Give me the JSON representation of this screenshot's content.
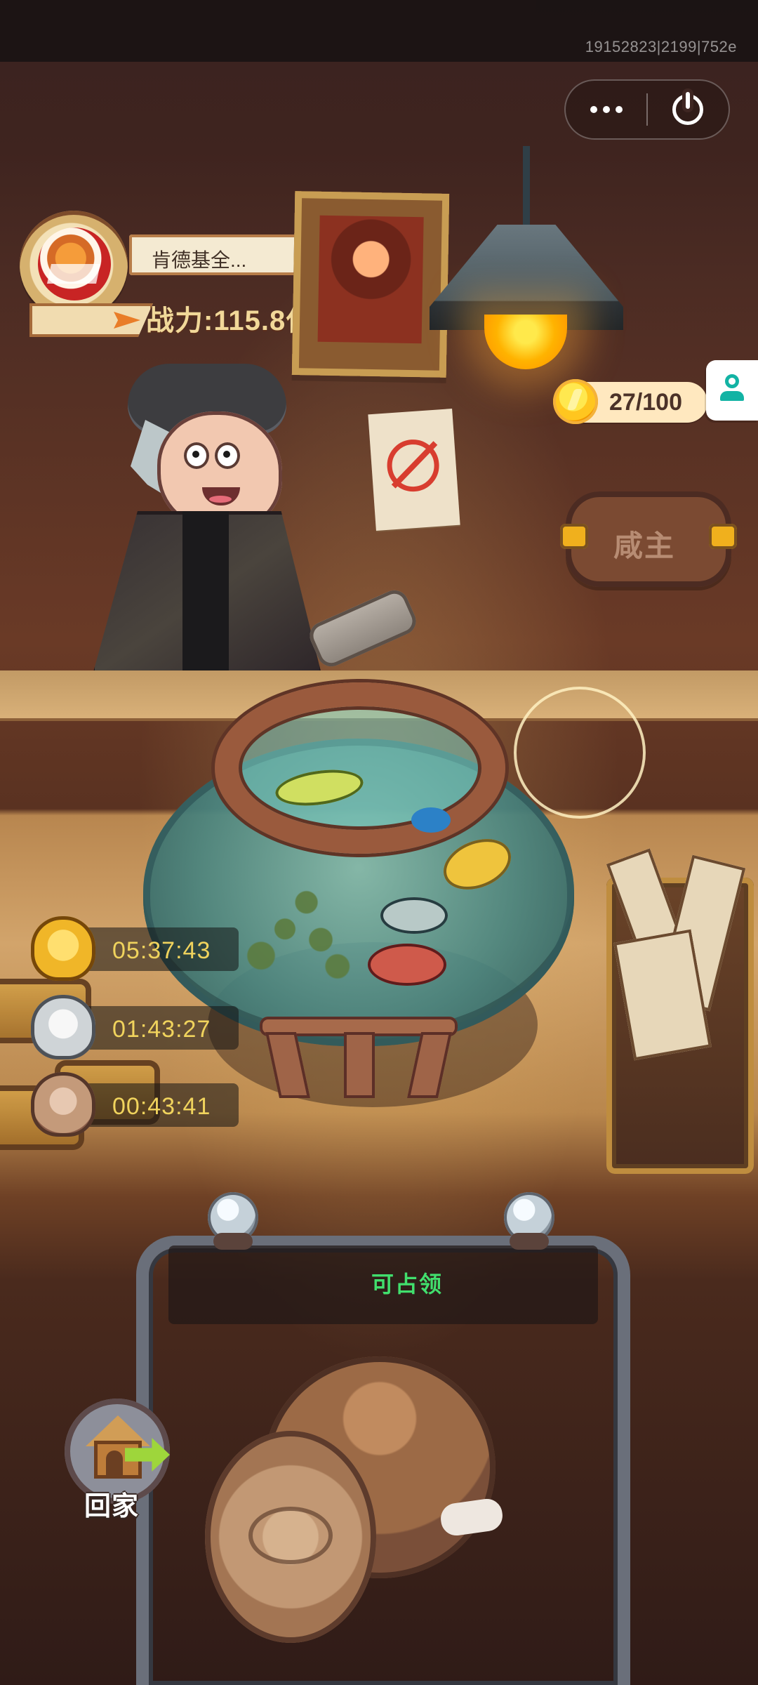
{
  "system": {
    "version_text": "19152823|2199|752e"
  },
  "capsule": {
    "more_icon": "more-icon",
    "power_icon": "power-icon"
  },
  "profile": {
    "name": "肯德基全...",
    "power": "战力:115.8亿"
  },
  "resources": {
    "coin_count": "27/100"
  },
  "sign": {
    "text": "咸主"
  },
  "timers": [
    {
      "icon": "gold-pot-icon",
      "time": "05:37:43"
    },
    {
      "icon": "silver-pot-icon",
      "time": "01:43:27"
    },
    {
      "icon": "clay-pot-icon",
      "time": "00:43:41"
    }
  ],
  "machine": {
    "status": "可占领"
  },
  "navigation": {
    "home_label": "回家"
  },
  "colors": {
    "claim_green": "#41df6d",
    "timer_gold": "#f0d35d",
    "gm_teal": "#13b3a4"
  }
}
